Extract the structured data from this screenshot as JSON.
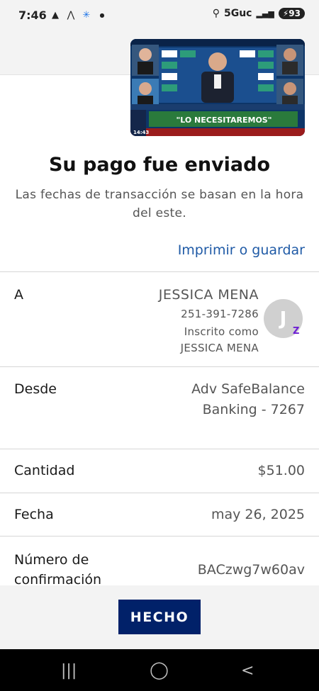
{
  "status_bar": {
    "time": "7:46",
    "network": "5Guc",
    "battery": "93"
  },
  "video": {
    "headline": "\"LO NECESITAREMOS\"",
    "clock": "14:43"
  },
  "payment": {
    "title": "Su pago fue enviado",
    "subtitle": "Las fechas de transacción se basan en la hora del este.",
    "print_link": "Imprimir o guardar"
  },
  "recipient": {
    "label": "A",
    "name": "JESSICA MENA",
    "phone": "251-391-7286",
    "enrolled_prefix": "Inscrito como",
    "enrolled_name": "JESSICA MENA",
    "avatar_initial": "J",
    "zelle_mark": "Z"
  },
  "from": {
    "label": "Desde",
    "line1": "Adv SafeBalance",
    "line2": "Banking - 7267"
  },
  "amount": {
    "label": "Cantidad",
    "value": "$51.00"
  },
  "date": {
    "label": "Fecha",
    "value": "may 26, 2025"
  },
  "confirmation": {
    "label": "Número de confirmación",
    "value": "BACzwg7w60av"
  },
  "footer": {
    "done_label": "HECHO"
  },
  "icons": {
    "nav_recent": "recent-apps-icon",
    "nav_home": "home-icon",
    "nav_back": "back-icon"
  },
  "colors": {
    "primary": "#012169",
    "link": "#1f5aa6",
    "zelle": "#6d1ed4"
  }
}
